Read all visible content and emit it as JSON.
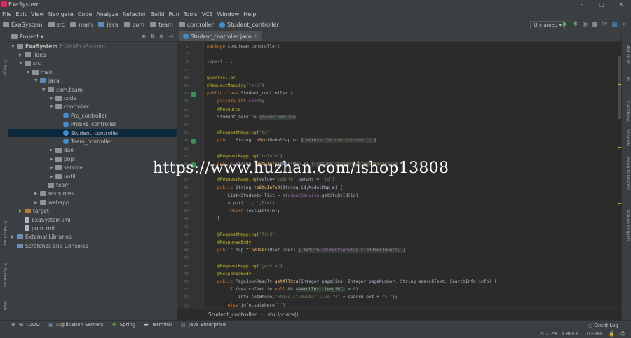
{
  "window": {
    "title": "ExaSystem"
  },
  "window_controls": [
    "–",
    "□",
    "✕"
  ],
  "menu": [
    "File",
    "Edit",
    "View",
    "Navigate",
    "Code",
    "Analyze",
    "Refactor",
    "Build",
    "Run",
    "Tools",
    "VCS",
    "Window",
    "Help"
  ],
  "breadcrumbs": [
    "ExaSystem",
    "src",
    "main",
    "java",
    "com",
    "team",
    "controller",
    "Student_controller"
  ],
  "run_config": "Unnamed",
  "project_panel": {
    "title": "Project",
    "tree": [
      {
        "label": "ExaSystem",
        "extra": "F:\\idu\\ExaSystem",
        "depth": 0,
        "arrow": "▼",
        "icon": "folder"
      },
      {
        "label": ".idea",
        "depth": 1,
        "arrow": "▶",
        "icon": "folder"
      },
      {
        "label": "src",
        "depth": 1,
        "arrow": "▼",
        "icon": "folder"
      },
      {
        "label": "main",
        "depth": 2,
        "arrow": "▼",
        "icon": "folder"
      },
      {
        "label": "java",
        "depth": 3,
        "arrow": "▼",
        "icon": "src"
      },
      {
        "label": "com.team",
        "depth": 4,
        "arrow": "▼",
        "icon": "folder"
      },
      {
        "label": "code",
        "depth": 5,
        "arrow": "▶",
        "icon": "folder"
      },
      {
        "label": "controller",
        "depth": 5,
        "arrow": "▼",
        "icon": "folder"
      },
      {
        "label": "Pro_controller",
        "depth": 6,
        "arrow": "",
        "icon": "class"
      },
      {
        "label": "ProExe_controller",
        "depth": 6,
        "arrow": "",
        "icon": "class"
      },
      {
        "label": "Student_controller",
        "depth": 6,
        "arrow": "",
        "icon": "class",
        "selected": true
      },
      {
        "label": "Team_controller",
        "depth": 6,
        "arrow": "",
        "icon": "class"
      },
      {
        "label": "dao",
        "depth": 5,
        "arrow": "▶",
        "icon": "folder"
      },
      {
        "label": "pojo",
        "depth": 5,
        "arrow": "▶",
        "icon": "folder"
      },
      {
        "label": "service",
        "depth": 5,
        "arrow": "▶",
        "icon": "folder"
      },
      {
        "label": "until",
        "depth": 5,
        "arrow": "▶",
        "icon": "folder"
      },
      {
        "label": "team",
        "depth": 4,
        "arrow": "",
        "icon": "folder"
      },
      {
        "label": "resources",
        "depth": 3,
        "arrow": "▶",
        "icon": "folder"
      },
      {
        "label": "webapp",
        "depth": 3,
        "arrow": "▶",
        "icon": "folder"
      },
      {
        "label": "target",
        "depth": 1,
        "arrow": "▶",
        "icon": "orange",
        "excluded": true
      },
      {
        "label": "ExaSystem.iml",
        "depth": 1,
        "arrow": "",
        "icon": "file"
      },
      {
        "label": "pom.xml",
        "depth": 1,
        "arrow": "",
        "icon": "file"
      },
      {
        "label": "External Libraries",
        "depth": 0,
        "arrow": "▶",
        "icon": "lib"
      },
      {
        "label": "Scratches and Consoles",
        "depth": 0,
        "arrow": "",
        "icon": "lib"
      }
    ]
  },
  "editor": {
    "tab": "Student_controller.java",
    "lines": [
      {
        "n": "1",
        "html": "<span class='kw'>package</span> com.team.controller;"
      },
      {
        "n": "2",
        "html": ""
      },
      {
        "n": "3",
        "html": "<span class='cm'>import ...</span>"
      },
      {
        "n": "17",
        "html": ""
      },
      {
        "n": "18",
        "html": "<span class='an'>@Controller</span>"
      },
      {
        "n": "19",
        "html": "<span class='an'>@RequestMapping</span>(<span class='st'>\"stu\"</span>)"
      },
      {
        "n": "20",
        "html": "<span class='kw'>public class</span> Student_controller {"
      },
      {
        "n": "21",
        "html": "    <span class='kw'>private int</span> <span class='fd'>count</span>;"
      },
      {
        "n": "22",
        "html": "    <span class='an'>@Resource</span>"
      },
      {
        "n": "23",
        "html": "    Student_service <span class='fd hl'>studentService</span>"
      },
      {
        "n": "24",
        "html": ""
      },
      {
        "n": "25",
        "html": "    <span class='an'>@RequestMapping</span>(<span class='st'>\"to\"</span>)"
      },
      {
        "n": "26",
        "html": "    <span class='kw'>public</span> String <span class='fn'>toStu</span>(ModelMap m) <span class='hint'>{ return <span class='st'>\"Student/student\"</span>; }</span>"
      },
      {
        "n": "29",
        "html": ""
      },
      {
        "n": "30",
        "html": "    <span class='an'>@RequestMapping</span>(<span class='st'>\"toInfo\"</span>)"
      },
      {
        "n": "31",
        "html": "    <span class='kw'>public</span> String <span class='fn'>toStuInfo</span>(ModelMap m) <span class='hint'>{ return <span class='st'>\"Student/studentInfo\"</span>; }</span>"
      },
      {
        "n": "34",
        "html": ""
      },
      {
        "n": "35",
        "html": "    <span class='an'>@RequestMapping</span>(value=<span class='st'>\"toInfo\"</span>,params = <span class='st'>\"id\"</span>)"
      },
      {
        "n": "36",
        "html": "    <span class='kw'>public</span> String <span class='fn'>toStuInfo2</span>(String id,ModelMap m) {"
      },
      {
        "n": "37",
        "html": "        List&lt;Student&gt; list = <span class='fd'>studentService</span>.getStuById(id)"
      },
      {
        "n": "38",
        "html": "        m.put(<span class='st'>\"list\"</span>,list)"
      },
      {
        "n": "39",
        "html": "        <span class='kw'>return</span> toStuInfo(m);"
      },
      {
        "n": "40",
        "html": "    }"
      },
      {
        "n": "41",
        "html": ""
      },
      {
        "n": "42",
        "html": "    <span class='an'>@RequestMapping</span>(<span class='st'>\"find\"</span>)"
      },
      {
        "n": "43",
        "html": "    <span class='an'>@ResponseBody</span>"
      },
      {
        "n": "44",
        "html": "    <span class='kw'>public</span> Map <span class='fn'>findUser</span>(User user) <span class='hint'>{ return <span class='fd'>studentService</span>.FindUser(user); }</span>"
      },
      {
        "n": "47",
        "html": ""
      },
      {
        "n": "48",
        "html": "    <span class='an'>@RequestMapping</span>(<span class='st'>\"getStu\"</span>)"
      },
      {
        "n": "49",
        "html": "    <span class='an'>@ResponseBody</span>"
      },
      {
        "n": "50",
        "html": "    <span class='kw'>public</span> PageJsonResult <span class='fn'>getAllStu</span>(Integer pageSize, Integer pageNumber, String searchText, SearchInfo info) {"
      },
      {
        "n": "51",
        "html": "        <span class='kw'>if</span> (searchText != <span class='kw'>null</span> &amp;&amp; <span class='hl'>searchText.length()</span> &gt; <span class='fd'>0</span>)"
      },
      {
        "n": "52",
        "html": "            info.setWhere(<span class='st'>\"where stuNumber like '%\"</span> + searchText + <span class='st'>\"%'\"</span>);"
      },
      {
        "n": "53",
        "html": "        <span class='kw'>else</span> info.setWhere(<span class='st'>\"\"</span>)"
      }
    ],
    "gutter_icons": [
      "20",
      "26",
      "31"
    ],
    "footer_path": [
      "Student_controller",
      "stuUpdate()"
    ]
  },
  "left_strip_labels": [
    "1: Project",
    "2: Structure",
    "2: Favorites",
    "Web"
  ],
  "right_strip_labels": [
    "Ant Build",
    "m",
    "Database",
    "SciView",
    "Bean Validation",
    "Maven Projects"
  ],
  "tool_windows": [
    {
      "label": "6: TODO",
      "icon": "≡"
    },
    {
      "label": "Application Servers",
      "icon": "▣"
    },
    {
      "label": "Spring",
      "icon": "❀"
    },
    {
      "label": "Terminal",
      "icon": "▬"
    },
    {
      "label": "Java Enterprise",
      "icon": "▤"
    }
  ],
  "event_log": "Event Log",
  "status": {
    "position": "202:29",
    "line_sep": "CRLF÷",
    "encoding": "UTF-8÷"
  },
  "watermark": "https://www.huzhan.com/ishop13808",
  "colors": {
    "bg": "#2b2b2b",
    "panel": "#3c3f41",
    "selection": "#0d293e",
    "keyword": "#cc7832",
    "annotation": "#bbb529",
    "string": "#6a8759",
    "method": "#ffc66d"
  }
}
